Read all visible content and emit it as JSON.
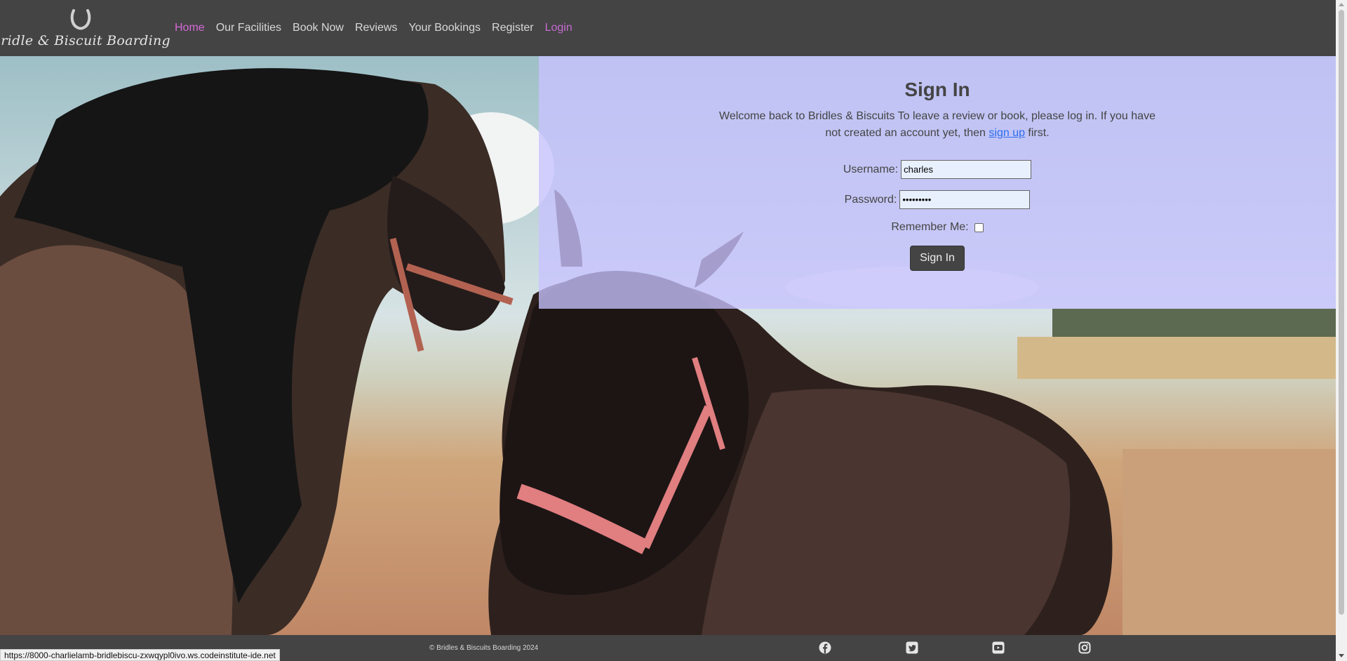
{
  "brand": {
    "name": "Bridle & Biscuit Boarding",
    "icon": "horseshoe-icon"
  },
  "nav": {
    "items": [
      {
        "label": "Home",
        "state": "active"
      },
      {
        "label": "Our Facilities"
      },
      {
        "label": "Book Now"
      },
      {
        "label": "Reviews"
      },
      {
        "label": "Your Bookings"
      },
      {
        "label": "Register"
      },
      {
        "label": "Login",
        "state": "accent"
      }
    ]
  },
  "signin": {
    "title": "Sign In",
    "welcome_prefix": "Welcome back to Bridles & Biscuits To leave a review or book, please log in. If you have not created an account yet, then ",
    "signup_link": "sign up",
    "welcome_suffix": " first.",
    "username_label": "Username:",
    "username_value": "charles",
    "password_label": "Password:",
    "password_value": "•••••••••",
    "remember_label": "Remember Me:",
    "remember_checked": false,
    "button": "Sign In"
  },
  "footer": {
    "copyright": "© Bridles & Biscuits Boarding 2024",
    "social": [
      "facebook-icon",
      "twitter-icon",
      "youtube-icon",
      "instagram-icon"
    ]
  },
  "status_bar": {
    "url": "https://8000-charlielamb-bridlebiscu-zxwqypl0ivo.ws.codeinstitute-ide.net"
  },
  "colors": {
    "navbar": "#444444",
    "active_link": "#d56ad8",
    "panel": "#c8c3ff",
    "link": "#2d6ef0"
  }
}
